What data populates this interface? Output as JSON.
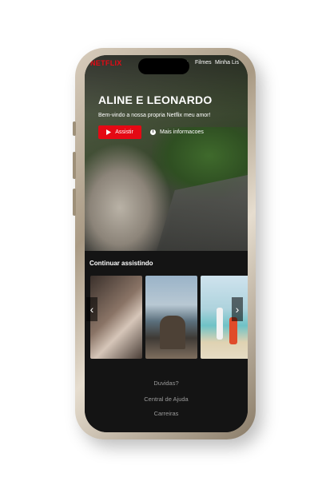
{
  "nav": {
    "logo": "NETFLIX",
    "partial_item": "s",
    "films": "Filmes",
    "my_list": "Minha Lis"
  },
  "hero": {
    "title": "ALINE E LEONARDO",
    "subtitle": "Bem-vindo a nossa propria Netflix meu amor!",
    "play_label": "Assistir",
    "info_label": "Mais informacoes"
  },
  "row": {
    "title": "Continuar assistindo",
    "prev_icon": "chevron-left-icon",
    "next_icon": "chevron-right-icon",
    "items": [
      "thumbnail-couple-closeup",
      "thumbnail-couple-mountains",
      "thumbnail-couple-beach"
    ]
  },
  "footer": {
    "links": [
      "Duvidas?",
      "Central de Ajuda",
      "Carreiras"
    ]
  },
  "colors": {
    "accent": "#e50914",
    "background": "#141414",
    "footer_text": "#9a9a9a"
  }
}
